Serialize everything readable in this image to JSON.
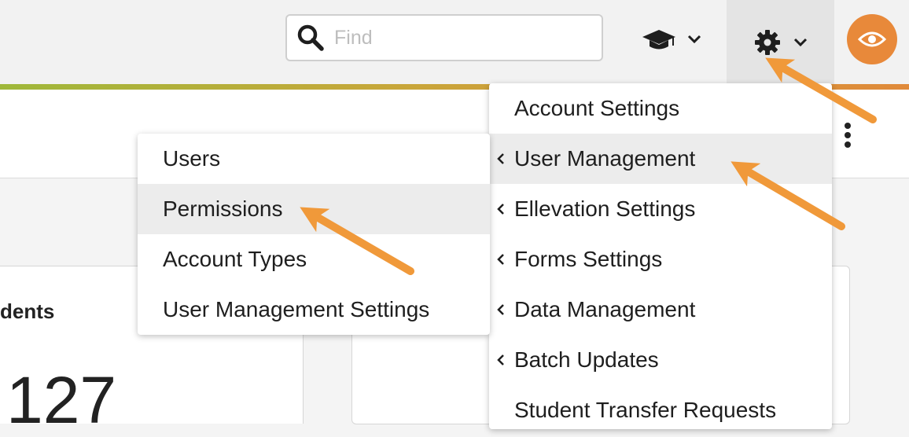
{
  "header": {
    "search": {
      "placeholder": "Find",
      "value": ""
    },
    "icons": {
      "search": "search-icon",
      "graduation": "graduation-cap-icon",
      "settings": "gear-icon",
      "view": "eye-icon",
      "dropdown": "chevron-down-icon"
    },
    "colors": {
      "accent": "#e8893a",
      "accent_line_start": "#9fb83a"
    }
  },
  "settings_menu": {
    "items": [
      {
        "label": "Account Settings",
        "has_submenu": false
      },
      {
        "label": "User Management",
        "has_submenu": true,
        "active": true
      },
      {
        "label": "Ellevation Settings",
        "has_submenu": true
      },
      {
        "label": "Forms Settings",
        "has_submenu": true
      },
      {
        "label": "Data Management",
        "has_submenu": true
      },
      {
        "label": "Batch Updates",
        "has_submenu": true
      },
      {
        "label": "Student Transfer Requests",
        "has_submenu": false
      }
    ]
  },
  "user_management_submenu": {
    "items": [
      {
        "label": "Users"
      },
      {
        "label": "Permissions",
        "active": true
      },
      {
        "label": "Account Types"
      },
      {
        "label": "User Management Settings"
      }
    ]
  },
  "background": {
    "card_title": "dents",
    "card_value": "127"
  }
}
